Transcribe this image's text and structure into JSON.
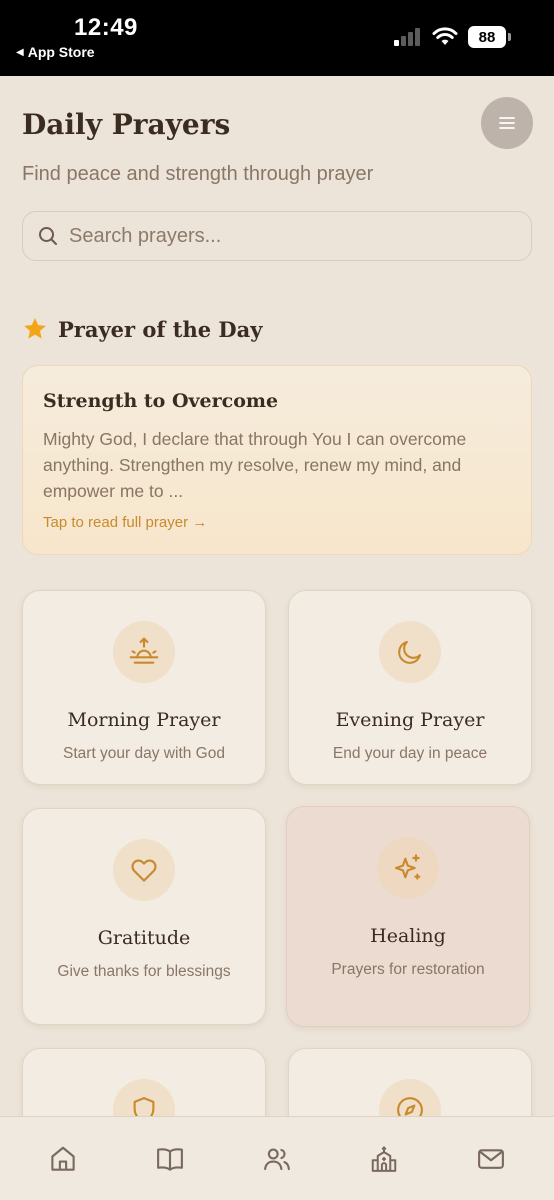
{
  "status": {
    "time": "12:49",
    "back_label": "App Store",
    "battery": "88"
  },
  "header": {
    "title": "Daily Prayers",
    "subtitle": "Find peace and strength through prayer"
  },
  "search": {
    "placeholder": "Search prayers..."
  },
  "prayer_of_day": {
    "heading": "Prayer of the Day",
    "title": "Strength to Overcome",
    "excerpt": "Mighty God, I declare that through You I can overcome anything. Strengthen my resolve, renew my mind, and empower me to ...",
    "link": "Tap to read full prayer →"
  },
  "categories": [
    {
      "title": "Morning Prayer",
      "desc": "Start your day with God",
      "icon": "sunrise-icon"
    },
    {
      "title": "Evening Prayer",
      "desc": "End your day in peace",
      "icon": "moon-icon"
    },
    {
      "title": "Gratitude",
      "desc": "Give thanks for blessings",
      "icon": "heart-icon"
    },
    {
      "title": "Healing",
      "desc": "Prayers for restoration",
      "icon": "sparkles-icon"
    },
    {
      "title": "",
      "desc": "",
      "icon": "shield-icon"
    },
    {
      "title": "",
      "desc": "",
      "icon": "compass-icon"
    }
  ],
  "nav": [
    "home-icon",
    "book-icon",
    "users-icon",
    "church-icon",
    "mail-icon"
  ],
  "colors": {
    "accent": "#c98a2e",
    "background": "#ece4d8",
    "card": "#f3ece2",
    "highlight_card": "#ebdbd0"
  }
}
